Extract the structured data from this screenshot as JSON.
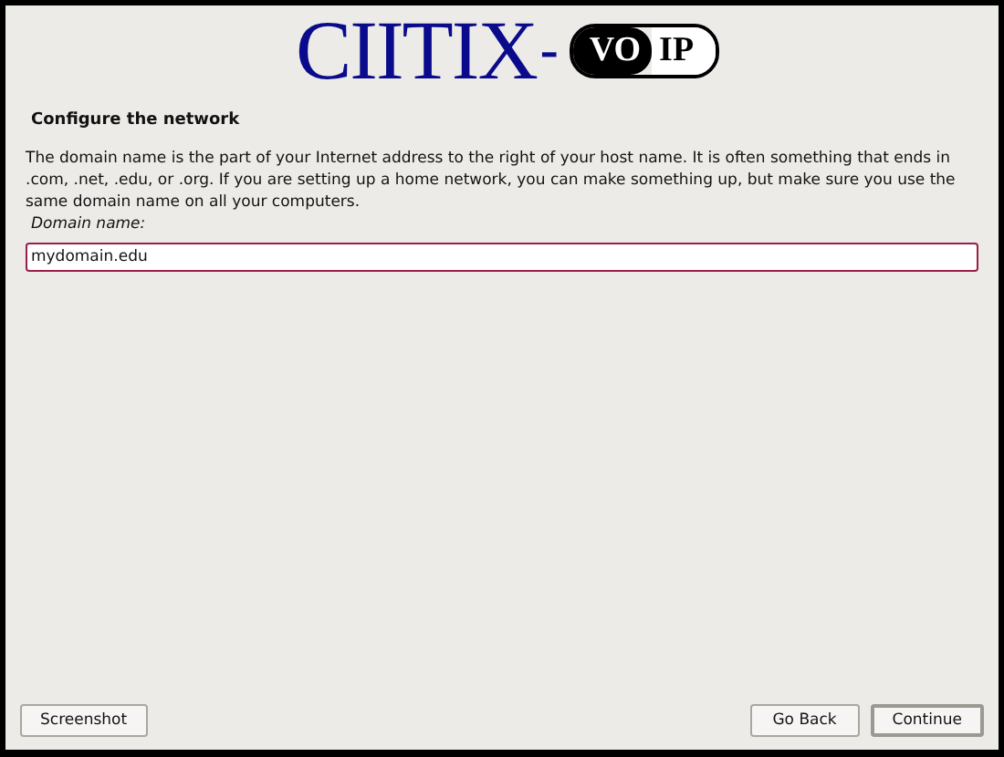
{
  "logo": {
    "main": "CIITIX",
    "dash": "-",
    "pill_left": "VO",
    "pill_right": "IP"
  },
  "title": "Configure the network",
  "description": "The domain name is the part of your Internet address to the right of your host name.  It is often something that ends in .com, .net, .edu, or .org.  If you are setting up a home network, you can make something up, but make sure you use the same domain name on all your computers.",
  "field": {
    "label": "Domain name:",
    "value": "mydomain.edu"
  },
  "buttons": [
    {
      "label": "Screenshot",
      "kind": "left",
      "default": false
    },
    {
      "label": "Go Back",
      "kind": "right",
      "default": false
    },
    {
      "label": "Continue",
      "kind": "right",
      "default": true
    }
  ]
}
